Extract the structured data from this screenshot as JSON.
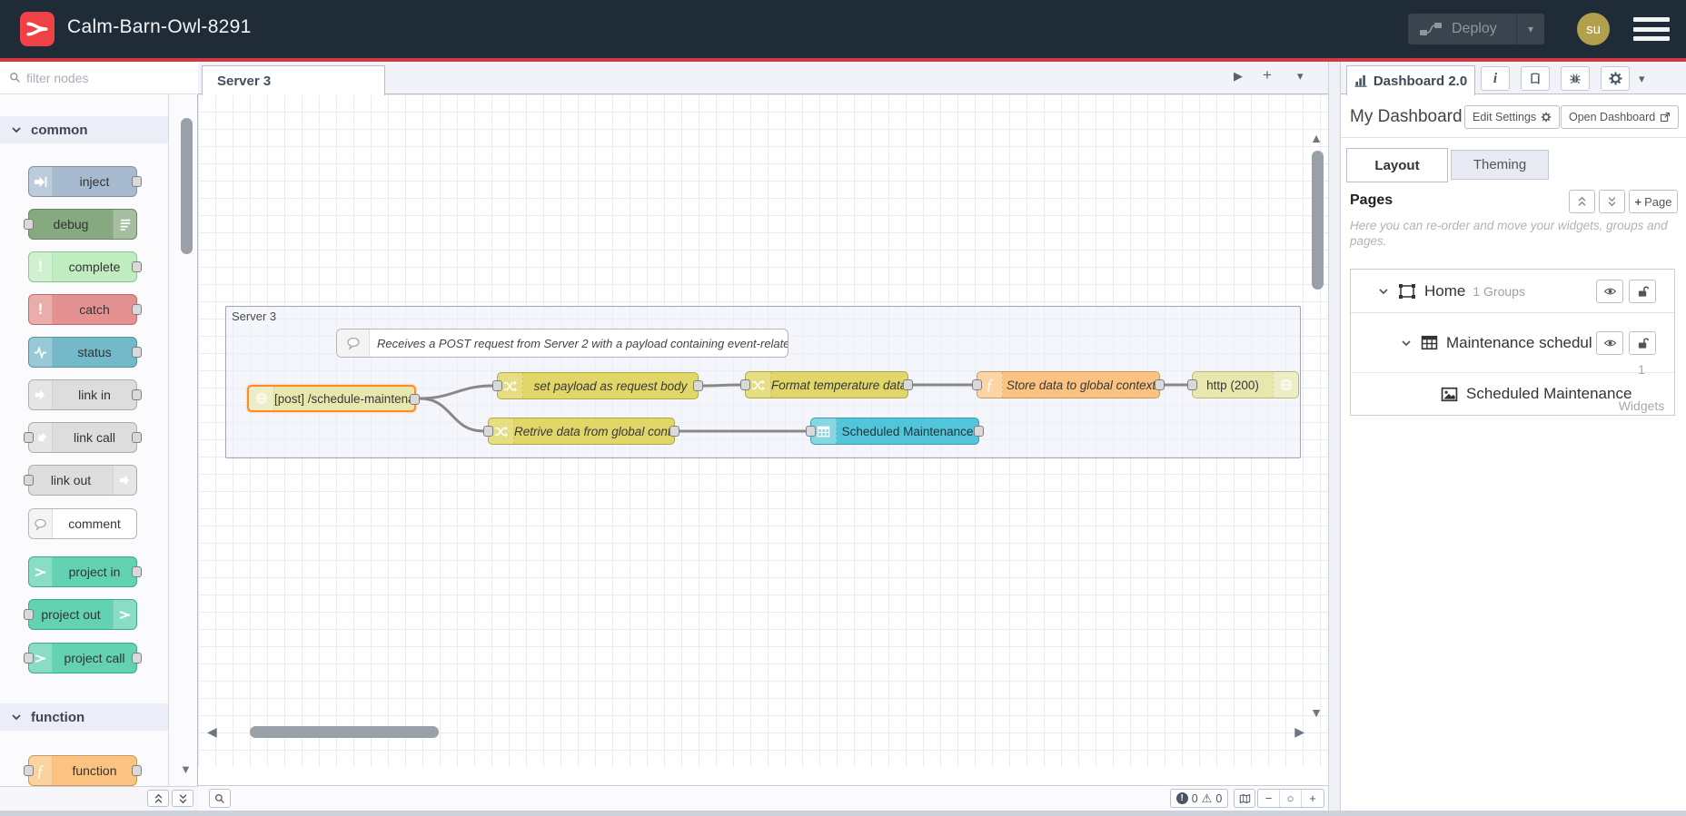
{
  "colors": {
    "accent_red": "#ef4146",
    "header_bg": "#202b38",
    "selection_orange": "#ff8b25",
    "node_http": "#e7e7ae",
    "node_change": "#e0d768",
    "node_function": "#fbc37f",
    "node_table": "#52c5d8",
    "node_inject": "#a6bbcf",
    "node_debug": "#87a980",
    "node_complete": "#c0edc0",
    "node_catch": "#e49191",
    "node_status": "#74b9c9",
    "node_link": "#dddddd",
    "node_project": "#62d2b3"
  },
  "icons": {
    "zoom_in": "+",
    "zoom_out": "−",
    "zoom_reset": "○",
    "scroll_up": "▲",
    "scroll_down": "▼",
    "scroll_left": "◀",
    "scroll_right": "▶",
    "sidebar_expand": "▶",
    "add_tab": "+",
    "dropdown_caret": "▾",
    "warning": "⚠",
    "exclamation": "!",
    "info": "i",
    "function_f": "ƒ",
    "plus": "+"
  },
  "header": {
    "title": "Calm-Barn-Owl-8291",
    "deploy": "Deploy",
    "avatar": "su"
  },
  "palette": {
    "filter_placeholder": "filter nodes",
    "category_common": "common",
    "category_function": "function",
    "items": {
      "inject": "inject",
      "debug": "debug",
      "complete": "complete",
      "catch": "catch",
      "status": "status",
      "link_in": "link in",
      "link_call": "link call",
      "link_out": "link out",
      "comment": "comment",
      "project_in": "project in",
      "project_out": "project out",
      "project_call": "project call",
      "function": "function"
    }
  },
  "workspace": {
    "tab": "Server 3",
    "group": "Server 3",
    "comment": "Receives a POST request from Server 2 with a payload containing event-related data.",
    "nodes": {
      "http_in": "[post] /schedule-maintenance",
      "set_payload": "set payload as request body",
      "format": "Format temperature data.",
      "store": "Store data to global context",
      "http_response": "http (200)",
      "retrieve": "Retrive data from global context",
      "table": "Scheduled Maintenance"
    }
  },
  "statusbar": {
    "errors": "0",
    "warnings": "0"
  },
  "sidebar": {
    "tab": "Dashboard 2.0",
    "dashboard_name": "My Dashboard",
    "edit_settings": "Edit Settings",
    "open_dashboard": "Open Dashboard",
    "tab_layout": "Layout",
    "tab_theming": "Theming",
    "pages": "Pages",
    "add_page": "Page",
    "help": "Here you can re-order and move your widgets, groups and pages.",
    "home_label": "Home",
    "home_meta": "1 Groups",
    "group_label": "Maintenance schedul...",
    "group_meta_count": "1",
    "group_meta_word": "Widgets",
    "widget_label": "Scheduled Maintenance"
  }
}
